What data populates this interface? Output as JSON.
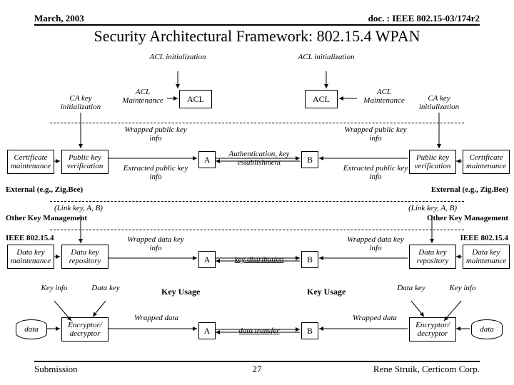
{
  "header": {
    "date": "March, 2003",
    "doc": "doc. : IEEE 802.15-03/174r2",
    "title": "Security Architectural Framework: 802.15.4 WPAN"
  },
  "footer": {
    "left": "Submission",
    "center": "27",
    "right": "Rene Struik, Certicom Corp."
  },
  "labels": {
    "acl_init": "ACL initialization",
    "acl": "ACL",
    "acl_maint": "ACL Maintenance",
    "ca_key_init": "CA key initialization",
    "wrapped_pub": "Wrapped public key info",
    "extracted_pub": "Extracted public key info",
    "cert_maint": "Certificate maintenance",
    "pub_verify": "Public key verification",
    "auth": "Authentication, key establishment",
    "external": "External (e.g., Zig.Bee)",
    "link_key": "(Link key, A, B)",
    "other_km": "Other Key Management",
    "ieee": "IEEE 802.15.4",
    "data_key_maint": "Data key maintenance",
    "data_key_repo": "Data key repository",
    "wrapped_data_key": "Wrapped data key info",
    "key_dist": "key distribution",
    "key_info": "Key info",
    "data_key": "Data key",
    "key_usage": "Key Usage",
    "data": "data",
    "enc_dec": "Encryptor/ decryptor",
    "wrapped_data": "Wrapped data",
    "data_transfer": "data transfer",
    "A": "A",
    "B": "B"
  }
}
